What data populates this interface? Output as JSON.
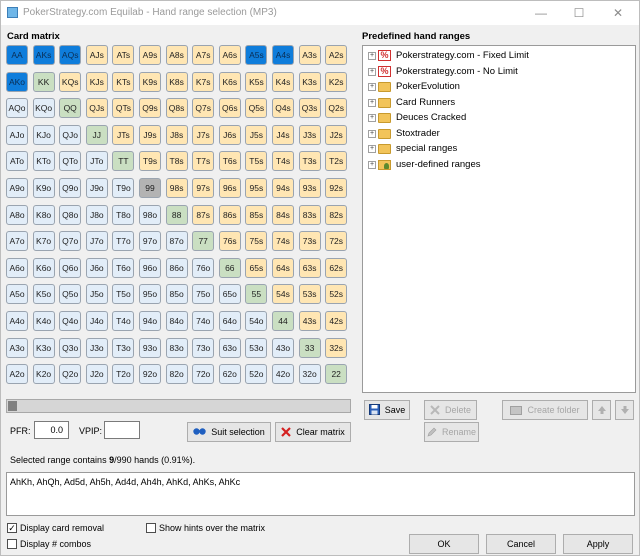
{
  "window": {
    "title": "PokerStrategy.com Equilab - Hand range selection (MP3)",
    "minimize": "—",
    "maximize": "☐",
    "close": "✕"
  },
  "card_matrix": {
    "label": "Card matrix",
    "ranks": [
      "A",
      "K",
      "Q",
      "J",
      "T",
      "9",
      "8",
      "7",
      "6",
      "5",
      "4",
      "3",
      "2"
    ],
    "selected": [
      "AA",
      "AKs",
      "AQs",
      "A5s",
      "A4s",
      "AKo"
    ],
    "hovered": [
      "99"
    ]
  },
  "predefined": {
    "label": "Predefined hand ranges",
    "items": [
      {
        "label": "Pokerstrategy.com - Fixed Limit",
        "icon": "pokerstrategy-icon"
      },
      {
        "label": "Pokerstrategy.com - No Limit",
        "icon": "pokerstrategy-icon"
      },
      {
        "label": "PokerEvolution",
        "icon": "folder-icon"
      },
      {
        "label": "Card Runners",
        "icon": "folder-icon"
      },
      {
        "label": "Deuces Cracked",
        "icon": "folder-icon"
      },
      {
        "label": "Stoxtrader",
        "icon": "folder-icon"
      },
      {
        "label": "special ranges",
        "icon": "folder-icon"
      },
      {
        "label": "user-defined ranges",
        "icon": "user-folder-icon"
      }
    ],
    "expander": "+"
  },
  "actions": {
    "save": "Save",
    "delete": "Delete",
    "create_folder": "Create folder",
    "rename": "Rename"
  },
  "pfr": {
    "label": "PFR:",
    "value": "0.0"
  },
  "vpip": {
    "label": "VPIP:",
    "value": ""
  },
  "buttons": {
    "suit_selection": "Suit selection",
    "clear_matrix": "Clear matrix",
    "ok": "OK",
    "cancel": "Cancel",
    "apply": "Apply"
  },
  "summary": {
    "prefix": "Selected range contains ",
    "count": "9",
    "suffix": "/990 hands (0.91%)."
  },
  "combos": "AhKh, AhQh, Ad5d, Ah5h, Ad4d, Ah4h, AhKd, AhKs, AhKc",
  "options": {
    "card_removal": {
      "label": "Display card removal",
      "checked": true
    },
    "hints": {
      "label": "Show hints over the matrix",
      "checked": false
    },
    "num_combos": {
      "label": "Display # combos",
      "checked": false
    }
  },
  "colors": {
    "pair": "#cadfc2",
    "suited": "#ffe6b3",
    "offsuit": "#e2edf8",
    "selected": "#0f7ddb",
    "hovered": "#b3b3b3"
  }
}
